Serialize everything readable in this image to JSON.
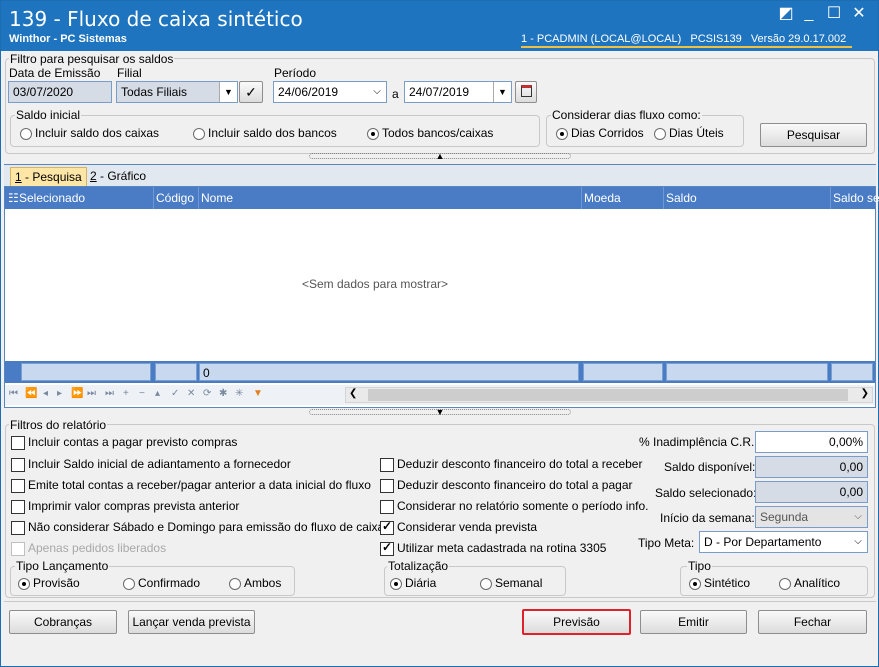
{
  "window": {
    "title": "139 - Fluxo de caixa sintético",
    "subtitle": "Winthor - PC Sistemas",
    "user": "1 - PCADMIN (LOCAL@LOCAL)",
    "routine": "PCSIS139",
    "version": "Versão  29.0.17.002",
    "controls": {
      "restore": "◩",
      "minimize": "_",
      "maximize": "☐",
      "close": "✕"
    }
  },
  "filter": {
    "legend": "Filtro para pesquisar os saldos",
    "emission_label": "Data de Emissão",
    "emission_value": "03/07/2020",
    "branch_label": "Filial",
    "branch_value": "Todas Filiais",
    "period_label": "Período",
    "period_from": "24/06/2019",
    "period_sep": "a",
    "period_to": "24/07/2019",
    "initial_balance": {
      "legend": "Saldo inicial",
      "options": [
        "Incluir saldo dos caixas",
        "Incluir saldo dos bancos",
        "Todos bancos/caixas"
      ],
      "selected": "Todos bancos/caixas"
    },
    "days": {
      "legend": "Considerar dias fluxo como:",
      "options": [
        "Dias Corridos",
        "Dias Úteis"
      ],
      "selected": "Dias Corridos"
    },
    "search_button": "Pesquisar"
  },
  "tabs": [
    {
      "key": "1",
      "label": " - Pesquisa",
      "active": true
    },
    {
      "key": "2",
      "label": " - Gráfico",
      "active": false
    }
  ],
  "grid": {
    "columns": [
      "Selecionado",
      "Código",
      "Nome",
      "Moeda",
      "Saldo",
      "Saldo se"
    ],
    "empty_text": "<Sem dados para mostrar>",
    "footer_count": "0"
  },
  "report_filters": {
    "legend": "Filtros do relatório",
    "left_checks": [
      {
        "label": "Incluir contas a pagar previsto compras",
        "checked": false,
        "disabled": false
      },
      {
        "label": "Incluir Saldo inicial de adiantamento a fornecedor",
        "checked": false,
        "disabled": false
      },
      {
        "label": "Emite total contas a receber/pagar anterior a data inicial do fluxo",
        "checked": false,
        "disabled": false
      },
      {
        "label": "Imprimir valor compras prevista anterior",
        "checked": false,
        "disabled": false
      },
      {
        "label": "Não considerar Sábado e Domingo para emissão do fluxo de caixa",
        "checked": false,
        "disabled": false
      },
      {
        "label": "Apenas pedidos liberados",
        "checked": false,
        "disabled": true
      }
    ],
    "mid_checks": [
      {
        "label": "Deduzir desconto financeiro do total a receber",
        "checked": false
      },
      {
        "label": "Deduzir desconto financeiro do total a pagar",
        "checked": false
      },
      {
        "label": "Considerar no relatório somente o período info.",
        "checked": false
      },
      {
        "label": "Considerar venda prevista",
        "checked": true
      },
      {
        "label": "Utilizar meta cadastrada na rotina 3305",
        "checked": true
      }
    ],
    "default_label": "% Inadimplência C.R.",
    "default_value": "0,00%",
    "available_label": "Saldo disponível:",
    "available_value": "0,00",
    "selected_label": "Saldo selecionado:",
    "selected_value": "0,00",
    "week_start_label": "Início da semana:",
    "week_start_value": "Segunda",
    "goal_type_label": "Tipo Meta:",
    "goal_type_value": "D - Por Departamento",
    "launch_type": {
      "legend": "Tipo Lançamento",
      "options": [
        "Provisão",
        "Confirmado",
        "Ambos"
      ],
      "selected": "Provisão"
    },
    "totalization": {
      "legend": "Totalização",
      "options": [
        "Diária",
        "Semanal"
      ],
      "selected": "Diária"
    },
    "type": {
      "legend": "Tipo",
      "options": [
        "Sintético",
        "Analítico"
      ],
      "selected": "Sintético"
    }
  },
  "buttons": {
    "charges": "Cobranças",
    "launch_forecast": "Lançar venda prevista",
    "forecast": "Previsão",
    "emit": "Emitir",
    "close": "Fechar"
  },
  "colors": {
    "titlebar": "#1e74bf",
    "grid_header": "#4a7cc6",
    "highlight": "#e0202a",
    "active_tab": "#fde6a6"
  }
}
